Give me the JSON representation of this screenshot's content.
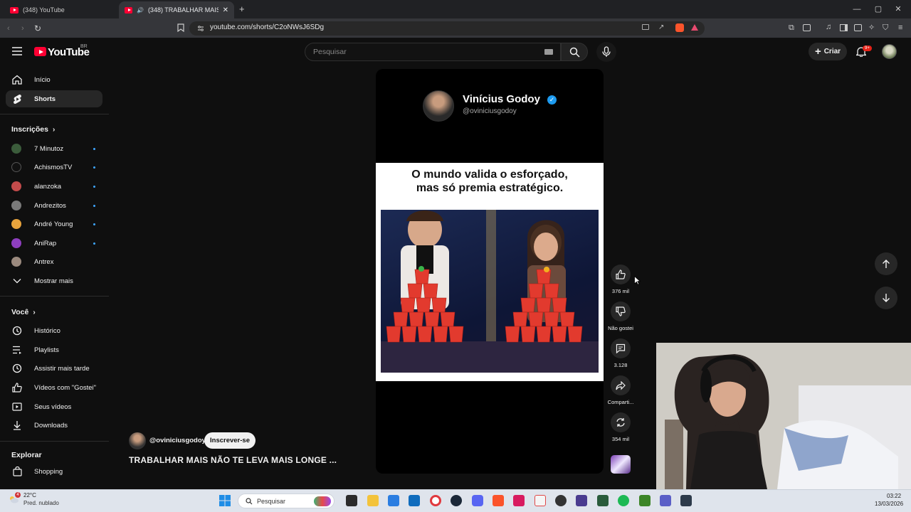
{
  "browser": {
    "tabs": [
      {
        "title": "(348) YouTube"
      },
      {
        "title": "(348) TRABALHAR MAIS NÃO"
      }
    ],
    "url": "youtube.com/shorts/C2oNWsJ6SDg"
  },
  "header": {
    "logo": "YouTube",
    "region": "BR",
    "search_placeholder": "Pesquisar",
    "create_label": "Criar",
    "notifications_badge": "9+"
  },
  "sidebar": {
    "main": [
      {
        "label": "Início",
        "icon": "home-icon"
      },
      {
        "label": "Shorts",
        "icon": "shorts-icon",
        "active": true
      }
    ],
    "subscriptions_title": "Inscrições",
    "subscriptions": [
      {
        "label": "7 Minutoz",
        "color": "#3b5c3b"
      },
      {
        "label": "AchismosTV",
        "color": "#111111"
      },
      {
        "label": "alanzoka",
        "color": "#c34b4b"
      },
      {
        "label": "Andrezitos",
        "color": "#7a7a7a"
      },
      {
        "label": "André Young",
        "color": "#e8a33c"
      },
      {
        "label": "AniRap",
        "color": "#8e3fbf"
      },
      {
        "label": "Antrex",
        "color": "#9b8a7e"
      }
    ],
    "show_more": "Mostrar mais",
    "you_title": "Você",
    "you_items": [
      {
        "label": "Histórico",
        "icon": "history-icon"
      },
      {
        "label": "Playlists",
        "icon": "playlists-icon"
      },
      {
        "label": "Assistir mais tarde",
        "icon": "clock-icon"
      },
      {
        "label": "Vídeos com \"Gostei\"",
        "icon": "like-icon"
      },
      {
        "label": "Seus vídeos",
        "icon": "video-icon"
      },
      {
        "label": "Downloads",
        "icon": "download-icon"
      }
    ],
    "explore_title": "Explorar",
    "explore_items": [
      {
        "label": "Shopping",
        "icon": "shopping-icon"
      }
    ]
  },
  "short": {
    "creator_name": "Vinícius Godoy",
    "creator_handle": "@oviniciusgodoy",
    "caption_line1": "O mundo valida o esforçado,",
    "caption_line2": "mas só premia estratégico.",
    "channel_handle": "@oviniciusgodoy",
    "subscribe_label": "Inscrever-se",
    "title": "TRABALHAR MAIS NÃO TE LEVA MAIS LONGE ..."
  },
  "actions": {
    "likes": "376 mil",
    "dislike_label": "Não gostei",
    "comments": "3.128",
    "share_label": "Comparti...",
    "remix": "354 mil"
  },
  "taskbar": {
    "temperature": "22°C",
    "weather": "Pred. nublado",
    "weather_badge": "4",
    "search_placeholder": "Pesquisar",
    "time": "03:22",
    "date": "13/03/2026"
  }
}
